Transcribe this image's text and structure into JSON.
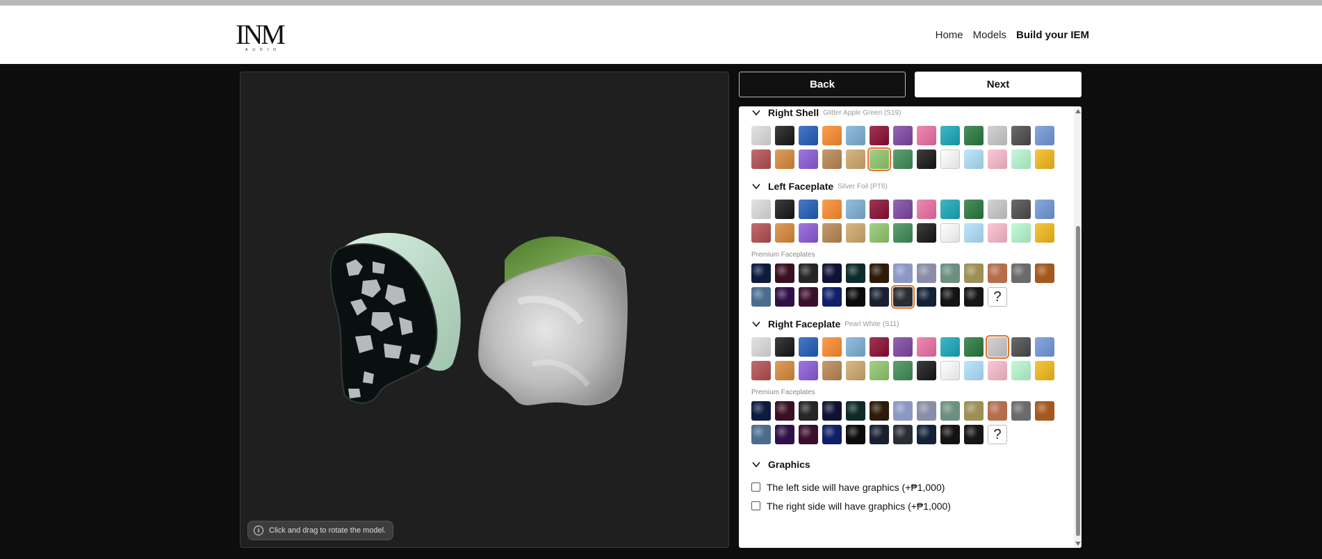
{
  "brand": {
    "logo_text": "INM",
    "logo_sub": "AUDIO"
  },
  "nav": {
    "home": "Home",
    "models": "Models",
    "build": "Build your IEM"
  },
  "viewer": {
    "hint": "Click and drag to rotate the model."
  },
  "buttons": {
    "back": "Back",
    "next": "Next"
  },
  "sections": {
    "right_shell": {
      "title": "Right Shell",
      "selected": "Glitter Apple Green (S19)"
    },
    "left_faceplate": {
      "title": "Left Faceplate",
      "selected": "Silver Foil (PT6)",
      "premium_label": "Premium Faceplates"
    },
    "right_faceplate": {
      "title": "Right Faceplate",
      "selected": "Pearl White (S11)",
      "premium_label": "Premium Faceplates"
    },
    "graphics": {
      "title": "Graphics",
      "left_option": "The left side will have graphics (+₱1,000)",
      "right_option": "The right side will have graphics (+₱1,000)"
    }
  },
  "swatches": {
    "standard": [
      "#dcdcdc",
      "#141414",
      "#1f5bb8",
      "#fb8a2b",
      "#7bafd6",
      "#8b0a30",
      "#7d44a3",
      "#ec6ea2",
      "#16a6b9",
      "#25773b",
      "#c9c9c9",
      "#4a4a4a",
      "#6f97d8",
      "#b24c4f",
      "#d78838",
      "#8a58d8",
      "#b88550",
      "#cfa76a",
      "#8fc66b",
      "#3c8a55",
      "#141414",
      "#ffffff",
      "#aee0fb",
      "#f9bacc",
      "#b7f8cf",
      "#f3b917"
    ],
    "premium": [
      "#0d1b3e",
      "#3a0f22",
      "#262626",
      "#101235",
      "#0d2b2a",
      "#2d1a08",
      "#8c97c4",
      "#8a8da8",
      "#6c8f80",
      "#9c9054",
      "#b56e4c",
      "#6b6b6b",
      "#a3581e",
      "#4b6c8d",
      "#2f1048",
      "#3a0f2c",
      "#0f1f68",
      "#0b0b0b",
      "#1a2030",
      "#2a2d33",
      "#142238",
      "#131313",
      "#161616",
      "?"
    ]
  },
  "selection": {
    "right_shell_index": 18,
    "left_premium_index": 19,
    "right_faceplate_index": 10
  }
}
